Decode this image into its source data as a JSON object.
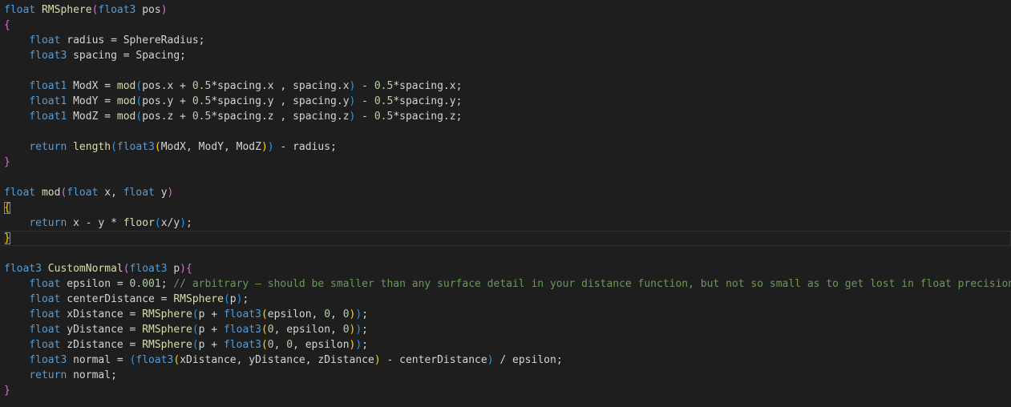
{
  "editor": {
    "colors": {
      "background": "#1e1e1e",
      "plain": "#d4d4d4",
      "keyword": "#569cd6",
      "function": "#dcdcaa",
      "number": "#b5cea8",
      "comment": "#6a9955",
      "bracket_level_1": "#da70d6",
      "bracket_level_2": "#179fff",
      "bracket_level_3": "#ffd700"
    },
    "lines": [
      {
        "tokens": [
          {
            "t": "float",
            "c": "keyword"
          },
          {
            "t": " ",
            "c": "plain"
          },
          {
            "t": "RMSphere",
            "c": "function"
          },
          {
            "t": "(",
            "c": "bracket1"
          },
          {
            "t": "float3",
            "c": "keyword"
          },
          {
            "t": " pos",
            "c": "plain"
          },
          {
            "t": ")",
            "c": "bracket1"
          }
        ]
      },
      {
        "tokens": [
          {
            "t": "{",
            "c": "bracket1"
          }
        ]
      },
      {
        "tokens": [
          {
            "t": "    ",
            "c": "plain"
          },
          {
            "t": "float",
            "c": "keyword"
          },
          {
            "t": " radius = SphereRadius;",
            "c": "plain"
          }
        ]
      },
      {
        "tokens": [
          {
            "t": "    ",
            "c": "plain"
          },
          {
            "t": "float3",
            "c": "keyword"
          },
          {
            "t": " spacing = Spacing;",
            "c": "plain"
          }
        ]
      },
      {
        "tokens": []
      },
      {
        "tokens": [
          {
            "t": "    ",
            "c": "plain"
          },
          {
            "t": "float1",
            "c": "keyword"
          },
          {
            "t": " ModX = ",
            "c": "plain"
          },
          {
            "t": "mod",
            "c": "function"
          },
          {
            "t": "(",
            "c": "bracket2"
          },
          {
            "t": "pos.x + ",
            "c": "plain"
          },
          {
            "t": "0.5",
            "c": "number"
          },
          {
            "t": "*spacing.x , spacing.x",
            "c": "plain"
          },
          {
            "t": ")",
            "c": "bracket2"
          },
          {
            "t": " - ",
            "c": "plain"
          },
          {
            "t": "0.5",
            "c": "number"
          },
          {
            "t": "*spacing.x;",
            "c": "plain"
          }
        ]
      },
      {
        "tokens": [
          {
            "t": "    ",
            "c": "plain"
          },
          {
            "t": "float1",
            "c": "keyword"
          },
          {
            "t": " ModY = ",
            "c": "plain"
          },
          {
            "t": "mod",
            "c": "function"
          },
          {
            "t": "(",
            "c": "bracket2"
          },
          {
            "t": "pos.y + ",
            "c": "plain"
          },
          {
            "t": "0.5",
            "c": "number"
          },
          {
            "t": "*spacing.y , spacing.y",
            "c": "plain"
          },
          {
            "t": ")",
            "c": "bracket2"
          },
          {
            "t": " - ",
            "c": "plain"
          },
          {
            "t": "0.5",
            "c": "number"
          },
          {
            "t": "*spacing.y;",
            "c": "plain"
          }
        ]
      },
      {
        "tokens": [
          {
            "t": "    ",
            "c": "plain"
          },
          {
            "t": "float1",
            "c": "keyword"
          },
          {
            "t": " ModZ = ",
            "c": "plain"
          },
          {
            "t": "mod",
            "c": "function"
          },
          {
            "t": "(",
            "c": "bracket2"
          },
          {
            "t": "pos.z + ",
            "c": "plain"
          },
          {
            "t": "0.5",
            "c": "number"
          },
          {
            "t": "*spacing.z , spacing.z",
            "c": "plain"
          },
          {
            "t": ")",
            "c": "bracket2"
          },
          {
            "t": " - ",
            "c": "plain"
          },
          {
            "t": "0.5",
            "c": "number"
          },
          {
            "t": "*spacing.z;",
            "c": "plain"
          }
        ]
      },
      {
        "tokens": []
      },
      {
        "tokens": [
          {
            "t": "    ",
            "c": "plain"
          },
          {
            "t": "return",
            "c": "keyword"
          },
          {
            "t": " ",
            "c": "plain"
          },
          {
            "t": "length",
            "c": "function"
          },
          {
            "t": "(",
            "c": "bracket2"
          },
          {
            "t": "float3",
            "c": "keyword"
          },
          {
            "t": "(",
            "c": "bracket3"
          },
          {
            "t": "ModX, ModY, ModZ",
            "c": "plain"
          },
          {
            "t": ")",
            "c": "bracket3"
          },
          {
            "t": ")",
            "c": "bracket2"
          },
          {
            "t": " - radius;",
            "c": "plain"
          }
        ]
      },
      {
        "tokens": [
          {
            "t": "}",
            "c": "bracket1"
          }
        ]
      },
      {
        "tokens": []
      },
      {
        "tokens": [
          {
            "t": "float",
            "c": "keyword"
          },
          {
            "t": " ",
            "c": "plain"
          },
          {
            "t": "mod",
            "c": "function"
          },
          {
            "t": "(",
            "c": "bracket1"
          },
          {
            "t": "float",
            "c": "keyword"
          },
          {
            "t": " x, ",
            "c": "plain"
          },
          {
            "t": "float",
            "c": "keyword"
          },
          {
            "t": " y",
            "c": "plain"
          },
          {
            "t": ")",
            "c": "bracket1"
          }
        ]
      },
      {
        "tokens": [
          {
            "t": "{",
            "c": "match"
          }
        ]
      },
      {
        "tokens": [
          {
            "t": "    ",
            "c": "plain"
          },
          {
            "t": "return",
            "c": "keyword"
          },
          {
            "t": " x - y * ",
            "c": "plain"
          },
          {
            "t": "floor",
            "c": "function"
          },
          {
            "t": "(",
            "c": "bracket2"
          },
          {
            "t": "x/y",
            "c": "plain"
          },
          {
            "t": ")",
            "c": "bracket2"
          },
          {
            "t": ";",
            "c": "plain"
          }
        ]
      },
      {
        "current": true,
        "tokens": [
          {
            "t": "}",
            "c": "match"
          }
        ]
      },
      {
        "tokens": []
      },
      {
        "tokens": [
          {
            "t": "float3",
            "c": "keyword"
          },
          {
            "t": " ",
            "c": "plain"
          },
          {
            "t": "CustomNormal",
            "c": "function"
          },
          {
            "t": "(",
            "c": "bracket1"
          },
          {
            "t": "float3",
            "c": "keyword"
          },
          {
            "t": " p",
            "c": "plain"
          },
          {
            "t": ")",
            "c": "bracket1"
          },
          {
            "t": "{",
            "c": "bracket1"
          }
        ]
      },
      {
        "tokens": [
          {
            "t": "    ",
            "c": "plain"
          },
          {
            "t": "float",
            "c": "keyword"
          },
          {
            "t": " epsilon = ",
            "c": "plain"
          },
          {
            "t": "0.001",
            "c": "number"
          },
          {
            "t": "; ",
            "c": "plain"
          },
          {
            "t": "// arbitrary — should be smaller than any surface detail in your distance function, but not so small as to get lost in float precision",
            "c": "comment"
          }
        ]
      },
      {
        "tokens": [
          {
            "t": "    ",
            "c": "plain"
          },
          {
            "t": "float",
            "c": "keyword"
          },
          {
            "t": " centerDistance = ",
            "c": "plain"
          },
          {
            "t": "RMSphere",
            "c": "function"
          },
          {
            "t": "(",
            "c": "bracket2"
          },
          {
            "t": "p",
            "c": "plain"
          },
          {
            "t": ")",
            "c": "bracket2"
          },
          {
            "t": ";",
            "c": "plain"
          }
        ]
      },
      {
        "tokens": [
          {
            "t": "    ",
            "c": "plain"
          },
          {
            "t": "float",
            "c": "keyword"
          },
          {
            "t": " xDistance = ",
            "c": "plain"
          },
          {
            "t": "RMSphere",
            "c": "function"
          },
          {
            "t": "(",
            "c": "bracket2"
          },
          {
            "t": "p + ",
            "c": "plain"
          },
          {
            "t": "float3",
            "c": "keyword"
          },
          {
            "t": "(",
            "c": "bracket3"
          },
          {
            "t": "epsilon, ",
            "c": "plain"
          },
          {
            "t": "0",
            "c": "number"
          },
          {
            "t": ", ",
            "c": "plain"
          },
          {
            "t": "0",
            "c": "number"
          },
          {
            "t": ")",
            "c": "bracket3"
          },
          {
            "t": ")",
            "c": "bracket2"
          },
          {
            "t": ";",
            "c": "plain"
          }
        ]
      },
      {
        "tokens": [
          {
            "t": "    ",
            "c": "plain"
          },
          {
            "t": "float",
            "c": "keyword"
          },
          {
            "t": " yDistance = ",
            "c": "plain"
          },
          {
            "t": "RMSphere",
            "c": "function"
          },
          {
            "t": "(",
            "c": "bracket2"
          },
          {
            "t": "p + ",
            "c": "plain"
          },
          {
            "t": "float3",
            "c": "keyword"
          },
          {
            "t": "(",
            "c": "bracket3"
          },
          {
            "t": "0",
            "c": "number"
          },
          {
            "t": ", epsilon, ",
            "c": "plain"
          },
          {
            "t": "0",
            "c": "number"
          },
          {
            "t": ")",
            "c": "bracket3"
          },
          {
            "t": ")",
            "c": "bracket2"
          },
          {
            "t": ";",
            "c": "plain"
          }
        ]
      },
      {
        "tokens": [
          {
            "t": "    ",
            "c": "plain"
          },
          {
            "t": "float",
            "c": "keyword"
          },
          {
            "t": " zDistance = ",
            "c": "plain"
          },
          {
            "t": "RMSphere",
            "c": "function"
          },
          {
            "t": "(",
            "c": "bracket2"
          },
          {
            "t": "p + ",
            "c": "plain"
          },
          {
            "t": "float3",
            "c": "keyword"
          },
          {
            "t": "(",
            "c": "bracket3"
          },
          {
            "t": "0",
            "c": "number"
          },
          {
            "t": ", ",
            "c": "plain"
          },
          {
            "t": "0",
            "c": "number"
          },
          {
            "t": ", epsilon",
            "c": "plain"
          },
          {
            "t": ")",
            "c": "bracket3"
          },
          {
            "t": ")",
            "c": "bracket2"
          },
          {
            "t": ";",
            "c": "plain"
          }
        ]
      },
      {
        "tokens": [
          {
            "t": "    ",
            "c": "plain"
          },
          {
            "t": "float3",
            "c": "keyword"
          },
          {
            "t": " normal = ",
            "c": "plain"
          },
          {
            "t": "(",
            "c": "bracket2"
          },
          {
            "t": "float3",
            "c": "keyword"
          },
          {
            "t": "(",
            "c": "bracket3"
          },
          {
            "t": "xDistance, yDistance, zDistance",
            "c": "plain"
          },
          {
            "t": ")",
            "c": "bracket3"
          },
          {
            "t": " - centerDistance",
            "c": "plain"
          },
          {
            "t": ")",
            "c": "bracket2"
          },
          {
            "t": " / epsilon;",
            "c": "plain"
          }
        ]
      },
      {
        "tokens": [
          {
            "t": "    ",
            "c": "plain"
          },
          {
            "t": "return",
            "c": "keyword"
          },
          {
            "t": " normal;",
            "c": "plain"
          }
        ]
      },
      {
        "tokens": [
          {
            "t": "}",
            "c": "bracket1"
          }
        ]
      }
    ]
  }
}
